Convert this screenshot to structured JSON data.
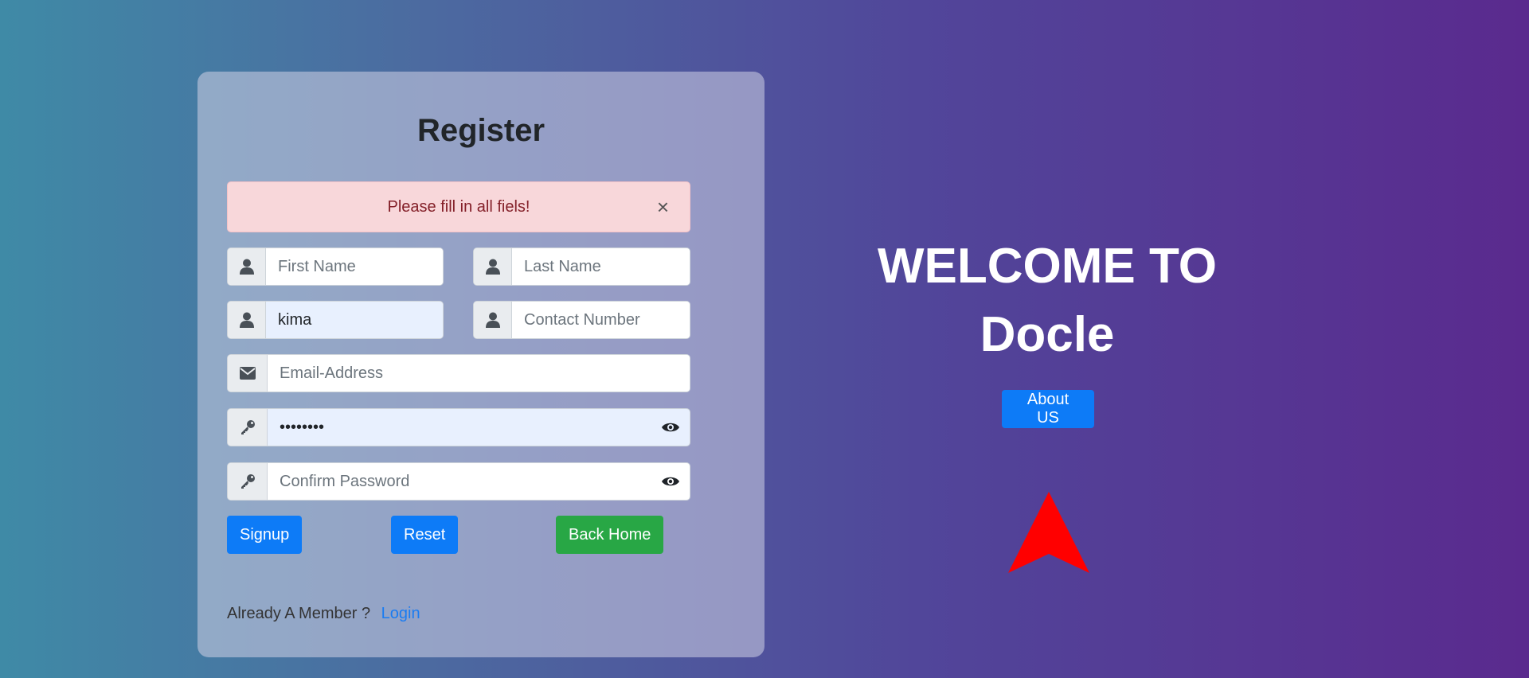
{
  "register": {
    "title": "Register",
    "alert": {
      "message": "Please fill in all fiels!",
      "close": "×"
    },
    "fields": {
      "first_name": {
        "value": "",
        "placeholder": "First Name",
        "icon": "user-icon"
      },
      "last_name": {
        "value": "",
        "placeholder": "Last Name",
        "icon": "user-icon"
      },
      "username": {
        "value": "kima",
        "placeholder": "",
        "icon": "user-icon"
      },
      "contact": {
        "value": "",
        "placeholder": "Contact Number",
        "icon": "user-icon"
      },
      "email": {
        "value": "",
        "placeholder": "Email-Address",
        "icon": "envelope-icon"
      },
      "password": {
        "value": "••••••••",
        "placeholder": "",
        "icon": "key-icon"
      },
      "confirm_password": {
        "value": "",
        "placeholder": "Confirm Password",
        "icon": "key-icon"
      }
    },
    "buttons": {
      "signup": "Signup",
      "reset": "Reset",
      "back_home": "Back Home"
    },
    "footer": {
      "text": "Already A Member ?",
      "login": "Login"
    }
  },
  "hero": {
    "line1": "WELCOME TO",
    "line2": "Docle",
    "about_button": "About US"
  },
  "colors": {
    "primary": "#0d7bf7",
    "success": "#28a745",
    "alert_bg": "#f8d7da",
    "alert_text": "#842029",
    "arrow": "#ff0000"
  }
}
